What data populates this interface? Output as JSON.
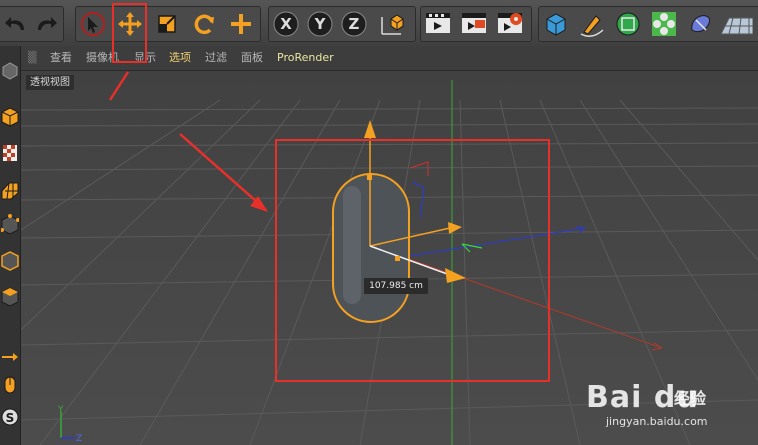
{
  "toolbar": {
    "axis_x": "X",
    "axis_y": "Y",
    "axis_z": "Z",
    "accent": "#f4a020"
  },
  "menubar": {
    "items": [
      "查看",
      "摄像机",
      "显示",
      "选项",
      "过滤",
      "面板",
      "ProRender"
    ],
    "active": "选项"
  },
  "viewport": {
    "label": "透视视图",
    "hud_value": "107.985 cm",
    "axis_y_label": "Y",
    "axis_z_label": "Z"
  },
  "watermark": {
    "logo": "Bai du",
    "cn": "经验",
    "url": "jingyan.baidu.com"
  },
  "colors": {
    "annotation": "#e8302a",
    "object": "#52575c",
    "x_axis": "#d03a2a",
    "y_axis": "#3aa83a",
    "z_axis": "#2a3ad8",
    "handle": "#f5a020"
  }
}
